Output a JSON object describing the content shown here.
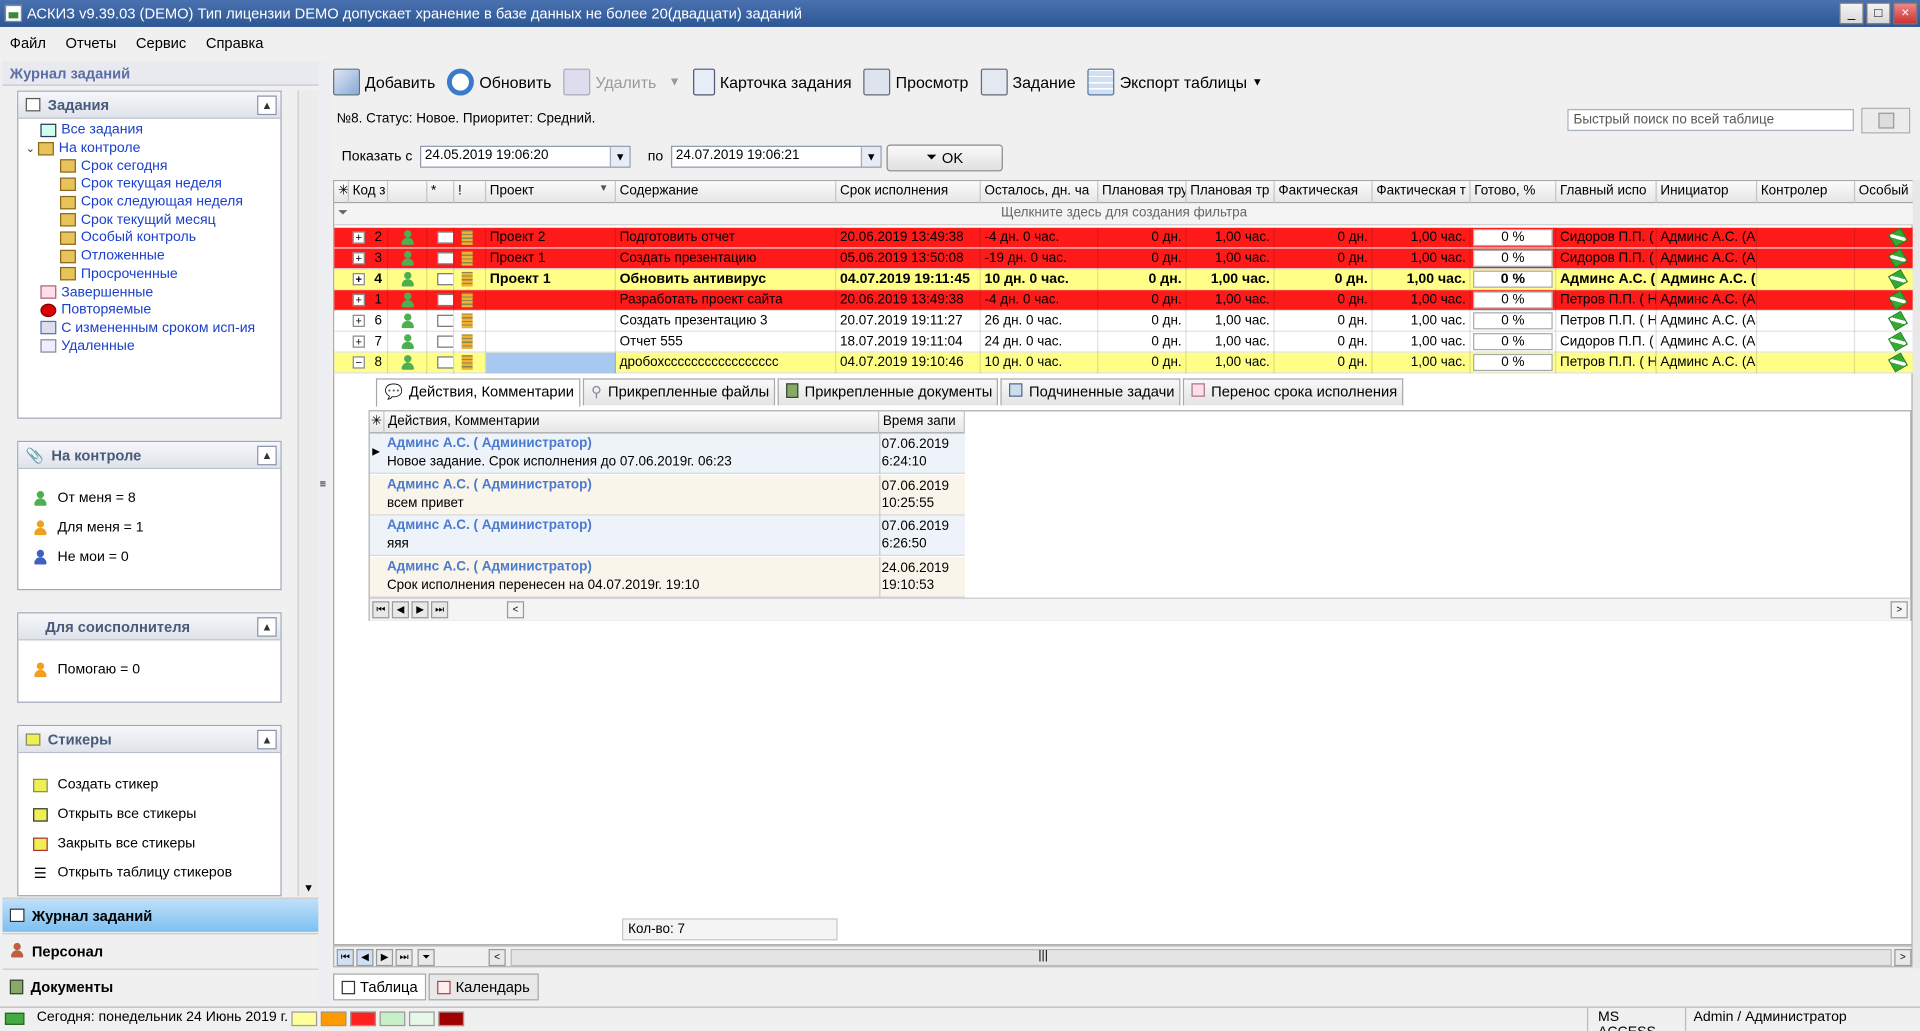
{
  "window": {
    "title": "АСКИЗ v9.39.03 (DEMO) Тип лицензии DEMO допускает хранение в базе данных не более 20(двадцати) заданий",
    "min": "_",
    "max": "□",
    "close": "×"
  },
  "menu": [
    "Файл",
    "Отчеты",
    "Сервис",
    "Справка"
  ],
  "left": {
    "header": "Журнал заданий",
    "tasks": {
      "title": "Задания",
      "items": [
        "Все задания",
        "На контроле",
        "Срок сегодня",
        "Срок текущая неделя",
        "Срок следующая неделя",
        "Срок текущий месяц",
        "Особый контроль",
        "Отложенные",
        "Просроченные",
        "Завершенные",
        "Повторяемые",
        "С измененным сроком исп-ия",
        "Удаленные"
      ]
    },
    "control": {
      "title": "На контроле",
      "items": [
        "От меня = 8",
        "Для меня = 1",
        "Не мои = 0"
      ]
    },
    "coexec": {
      "title": "Для соисполнителя",
      "items": [
        "Помогаю = 0"
      ]
    },
    "stickers": {
      "title": "Стикеры",
      "items": [
        "Создать стикер",
        "Открыть все стикеры",
        "Закрыть все стикеры",
        "Открыть таблицу стикеров"
      ]
    },
    "nav": [
      "Журнал заданий",
      "Персонал",
      "Документы"
    ]
  },
  "toolbar": {
    "add": "Добавить",
    "refresh": "Обновить",
    "delete": "Удалить",
    "card": "Карточка задания",
    "preview": "Просмотр",
    "task": "Задание",
    "export": "Экспорт таблицы"
  },
  "status_line": "№8. Статус: Новое.  Приоритет: Средний.",
  "search_placeholder": "Быстрый поиск по всей таблице",
  "filter": {
    "show_from": "Показать с",
    "from": "24.05.2019 19:06:20",
    "to_label": "по",
    "to": "24.07.2019 19:06:21",
    "ok": "OK"
  },
  "grid": {
    "headers": [
      "Код з",
      "",
      "*",
      "!",
      "Проект",
      "Содержание",
      "Срок исполнения",
      "Осталось, дн. ча",
      "Плановая тру",
      "Плановая тр",
      "Фактическая",
      "Фактическая т",
      "Готово, %",
      "Главный испо",
      "Инициатор",
      "Контролер",
      "Особый"
    ],
    "filter_hint": "Щелкните здесь для создания фильтра",
    "rows": [
      {
        "code": "2",
        "project": "Проект 2",
        "content": "Подготовить отчет",
        "due": "20.06.2019 13:49:38",
        "left": "-4 дн. 0 час.",
        "plan1": "0 дн.",
        "plan2": "1,00 час.",
        "fact1": "0 дн.",
        "fact2": "1,00 час.",
        "ready": "0 %",
        "main": "Сидоров П.П. (",
        "init": "Админс А.С. (А",
        "ctrl": "",
        "style": "red"
      },
      {
        "code": "3",
        "project": "Проект 1",
        "content": "Создать презентацию",
        "due": "05.06.2019 13:50:08",
        "left": "-19 дн. 0 час.",
        "plan1": "0 дн.",
        "plan2": "1,00 час.",
        "fact1": "0 дн.",
        "fact2": "1,00 час.",
        "ready": "0 %",
        "main": "Сидоров П.П. (",
        "init": "Админс А.С. (А",
        "ctrl": "",
        "style": "red"
      },
      {
        "code": "4",
        "project": "Проект 1",
        "content": "Обновить антивирус",
        "due": "04.07.2019 19:11:45",
        "left": "10 дн. 0 час.",
        "plan1": "0 дн.",
        "plan2": "1,00 час.",
        "fact1": "0 дн.",
        "fact2": "1,00 час.",
        "ready": "0 %",
        "main": "Админс А.С. (",
        "init": "Админс А.С. (",
        "ctrl": "",
        "style": "yellowbold"
      },
      {
        "code": "1",
        "project": "",
        "content": "Разработать проект сайта",
        "due": "20.06.2019 13:49:38",
        "left": "-4 дн. 0 час.",
        "plan1": "0 дн.",
        "plan2": "1,00 час.",
        "fact1": "0 дн.",
        "fact2": "1,00 час.",
        "ready": "0 %",
        "main": "Петров П.П. ( Н",
        "init": "Админс А.С. (А",
        "ctrl": "",
        "style": "red"
      },
      {
        "code": "6",
        "project": "",
        "content": "Создать презентацию 3",
        "due": "20.07.2019 19:11:27",
        "left": "26 дн. 0 час.",
        "plan1": "0 дн.",
        "plan2": "1,00 час.",
        "fact1": "0 дн.",
        "fact2": "1,00 час.",
        "ready": "0 %",
        "main": "Петров П.П. ( Н",
        "init": "Админс А.С. (А",
        "ctrl": "",
        "style": "white"
      },
      {
        "code": "7",
        "project": "",
        "content": "Отчет 555",
        "due": "18.07.2019 19:11:04",
        "left": "24 дн. 0 час.",
        "plan1": "0 дн.",
        "plan2": "1,00 час.",
        "fact1": "0 дн.",
        "fact2": "1,00 час.",
        "ready": "0 %",
        "main": "Сидоров П.П. (",
        "init": "Админс А.С. (А",
        "ctrl": "",
        "style": "white"
      },
      {
        "code": "8",
        "project": "",
        "content": "дробохссссссссссссссссс",
        "due": "04.07.2019 19:10:46",
        "left": "10 дн. 0 час.",
        "plan1": "0 дн.",
        "plan2": "1,00 час.",
        "fact1": "0 дн.",
        "fact2": "1,00 час.",
        "ready": "0 %",
        "main": "Петров П.П. ( Н",
        "init": "Админс А.С. (А",
        "ctrl": "",
        "style": "yellow"
      }
    ],
    "count": "Кол-во: 7"
  },
  "detail": {
    "tabs": [
      "Действия, Комментарии",
      "Прикрепленные файлы",
      "Прикрепленные документы",
      "Подчиненные задачи",
      "Перенос срока исполнения"
    ],
    "headers": [
      "Действия, Комментарии",
      "Время запи"
    ],
    "comments": [
      {
        "who": "Админс А.С. ( Администратор)",
        "text": "Новое задание. Срок исполнения до 07.06.2019г. 06:23",
        "date": "07.06.2019",
        "time": "6:24:10"
      },
      {
        "who": "Админс А.С. ( Администратор)",
        "text": "всем привет",
        "date": "07.06.2019",
        "time": "10:25:55"
      },
      {
        "who": "Админс А.С. ( Администратор)",
        "text": "яяя",
        "date": "07.06.2019",
        "time": "6:26:50"
      },
      {
        "who": "Админс А.С. ( Администратор)",
        "text": "Срок исполнения перенесен на 04.07.2019г. 19:10",
        "date": "24.06.2019",
        "time": "19:10:53"
      }
    ]
  },
  "bottom_tabs": [
    "Таблица",
    "Календарь"
  ],
  "statusbar": {
    "today": "Сегодня: понедельник 24 Июнь 2019 г.",
    "db": "MS ACCESS",
    "user": "Admin / Администратор",
    "swatches": [
      "#ffff99",
      "#ff9900",
      "#ff2020",
      "#c8f0c8",
      "#e8f8e8",
      "#a00000"
    ]
  },
  "colors": {
    "red": "#ff1a1a",
    "yellow": "#ffff88",
    "selected": "#a8c8f0"
  }
}
